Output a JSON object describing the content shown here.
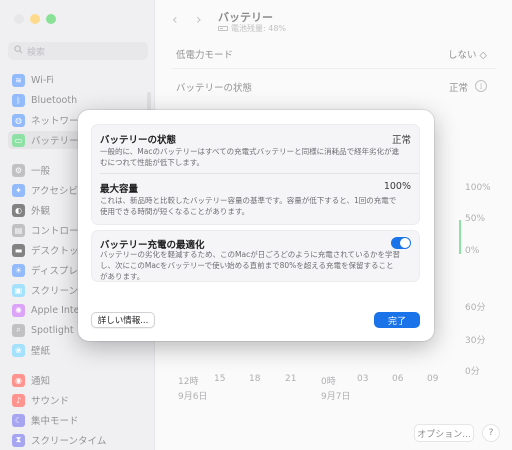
{
  "sidebar": {
    "search_placeholder": "検索",
    "items": [
      {
        "label": "Wi-Fi",
        "icon": "wifi-icon",
        "color": "#3b82f6"
      },
      {
        "label": "Bluetooth",
        "icon": "bluetooth-icon",
        "color": "#3b82f6"
      },
      {
        "label": "ネットワーク",
        "icon": "globe-icon",
        "color": "#3b82f6"
      },
      {
        "label": "バッテリー",
        "icon": "battery-icon",
        "color": "#34c759"
      },
      {
        "label": "一般",
        "icon": "gear-icon",
        "color": "#8e8e93"
      },
      {
        "label": "アクセシビリティ",
        "icon": "accessibility-icon",
        "color": "#3b82f6"
      },
      {
        "label": "外観",
        "icon": "appearance-icon",
        "color": "#1c1c1e"
      },
      {
        "label": "コントロールセンター",
        "icon": "control-center-icon",
        "color": "#8e8e93"
      },
      {
        "label": "デスクトップとDock",
        "icon": "dock-icon",
        "color": "#1c1c1e"
      },
      {
        "label": "ディスプレイ",
        "icon": "display-icon",
        "color": "#3b82f6"
      },
      {
        "label": "スクリーンセーバ",
        "icon": "screensaver-icon",
        "color": "#5ac8fa"
      },
      {
        "label": "Apple Intelligence",
        "icon": "apple-intelligence-icon",
        "color": "#bf5af2"
      },
      {
        "label": "Spotlight",
        "icon": "spotlight-icon",
        "color": "#8e8e93"
      },
      {
        "label": "壁紙",
        "icon": "wallpaper-icon",
        "color": "#5ac8fa"
      },
      {
        "label": "通知",
        "icon": "notifications-icon",
        "color": "#ff3b30"
      },
      {
        "label": "サウンド",
        "icon": "sound-icon",
        "color": "#ff3b30"
      },
      {
        "label": "集中モード",
        "icon": "focus-icon",
        "color": "#5e5ce6"
      },
      {
        "label": "スクリーンタイム",
        "icon": "screen-time-icon",
        "color": "#5e5ce6"
      }
    ]
  },
  "main": {
    "title": "バッテリー",
    "subtitle": "電池残量: 48%",
    "low_power_label": "低電力モード",
    "low_power_value": "しない ◇",
    "battery_health_label": "バッテリーの状態",
    "battery_health_value": "正常",
    "chart_y_labels": [
      "100%",
      "50%",
      "0%",
      "60分",
      "30分",
      "0分"
    ],
    "chart_x_labels": [
      "12時",
      "15",
      "18",
      "21",
      "0時",
      "03",
      "06",
      "09"
    ],
    "chart_dates": [
      "9月6日",
      "9月7日"
    ],
    "options_button": "オプション...",
    "help_button": "?"
  },
  "sheet": {
    "health_title": "バッテリーの状態",
    "health_value": "正常",
    "health_desc": "一般的に、Macのバッテリーはすべての充電式バッテリーと同様に消耗品で経年劣化が進むにつれて性能が低下します。",
    "capacity_title": "最大容量",
    "capacity_value": "100%",
    "capacity_desc": "これは、新品時と比較したバッテリー容量の基準です。容量が低下すると、1回の充電で使用できる時間が短くなることがあります。",
    "optimize_title": "バッテリー充電の最適化",
    "optimize_enabled": true,
    "optimize_desc": "バッテリーの劣化を軽減するため、このMacが日ごろどのように充電されているかを学習し、次にこのMacをバッテリーで使い始める直前まで80%を超える充電を保留することがあります。",
    "details_button": "詳しい情報...",
    "done_button": "完了"
  },
  "colors": {
    "accent": "#1a73e8",
    "green": "#34c759"
  }
}
